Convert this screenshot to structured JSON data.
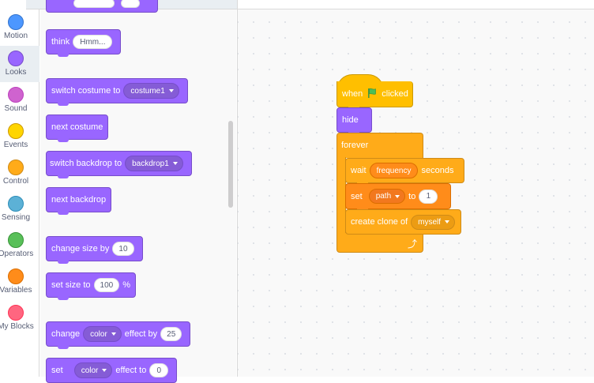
{
  "categories": [
    {
      "label": "Motion",
      "color": "#4c97ff"
    },
    {
      "label": "Looks",
      "color": "#9966ff",
      "selected": true
    },
    {
      "label": "Sound",
      "color": "#cf63cf"
    },
    {
      "label": "Events",
      "color": "#ffd500"
    },
    {
      "label": "Control",
      "color": "#ffab19"
    },
    {
      "label": "Sensing",
      "color": "#5cb1d6"
    },
    {
      "label": "Operators",
      "color": "#59c059"
    },
    {
      "label": "Variables",
      "color": "#ff8c1a"
    },
    {
      "label": "My Blocks",
      "color": "#ff6680"
    }
  ],
  "palette": {
    "think": {
      "label": "think",
      "value": "Hmm..."
    },
    "switch_costume": {
      "label": "switch costume to",
      "value": "costume1"
    },
    "next_costume": {
      "label": "next costume"
    },
    "switch_backdrop": {
      "label": "switch backdrop to",
      "value": "backdrop1"
    },
    "next_backdrop": {
      "label": "next backdrop"
    },
    "change_size": {
      "label": "change size by",
      "value": "10"
    },
    "set_size": {
      "label": "set size to",
      "value": "100",
      "suffix": "%"
    },
    "change_effect": {
      "label": "change",
      "effect": "color",
      "label2": "effect by",
      "value": "25"
    },
    "set_effect": {
      "label": "set",
      "effect": "color",
      "label2": "effect to",
      "value": "0"
    }
  },
  "script": {
    "when_flag": {
      "label1": "when",
      "label2": "clicked",
      "icon": "green-flag-icon"
    },
    "hide": {
      "label": "hide"
    },
    "forever": {
      "label": "forever",
      "icon": "loop-arrow-icon"
    },
    "wait": {
      "label1": "wait",
      "reporter": "frequency",
      "label2": "seconds"
    },
    "set_var": {
      "label1": "set",
      "variable": "path",
      "label2": "to",
      "value": "1"
    },
    "create_clone": {
      "label": "create clone of",
      "target": "myself"
    }
  },
  "colors": {
    "looks": "#9966ff",
    "events": "#ffbf00",
    "control": "#ffab19",
    "variables": "#ff8c1a"
  }
}
